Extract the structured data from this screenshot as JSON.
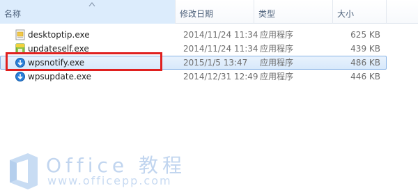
{
  "columns": {
    "name": "名称",
    "date": "修改日期",
    "type": "类型",
    "size": "大小"
  },
  "files": [
    {
      "name": "desktoptip.exe",
      "date": "2014/11/24 11:34",
      "type": "应用程序",
      "size": "625 KB",
      "icon": "desktoptip-app-icon",
      "selected": false
    },
    {
      "name": "updateself.exe",
      "date": "2014/11/24 11:34",
      "type": "应用程序",
      "size": "439 KB",
      "icon": "updateself-app-icon",
      "selected": false
    },
    {
      "name": "wpsnotify.exe",
      "date": "2015/1/5 13:47",
      "type": "应用程序",
      "size": "486 KB",
      "icon": "wps-update-icon",
      "selected": true
    },
    {
      "name": "wpsupdate.exe",
      "date": "2014/12/31 12:49",
      "type": "应用程序",
      "size": "446 KB",
      "icon": "wps-update-icon",
      "selected": false
    }
  ],
  "watermark": {
    "title": "Office 教程",
    "url": "www.officepp.com"
  },
  "colors": {
    "highlight": "#e0201f",
    "selection": "#d8e9fb",
    "header_text": "#4c607a"
  }
}
